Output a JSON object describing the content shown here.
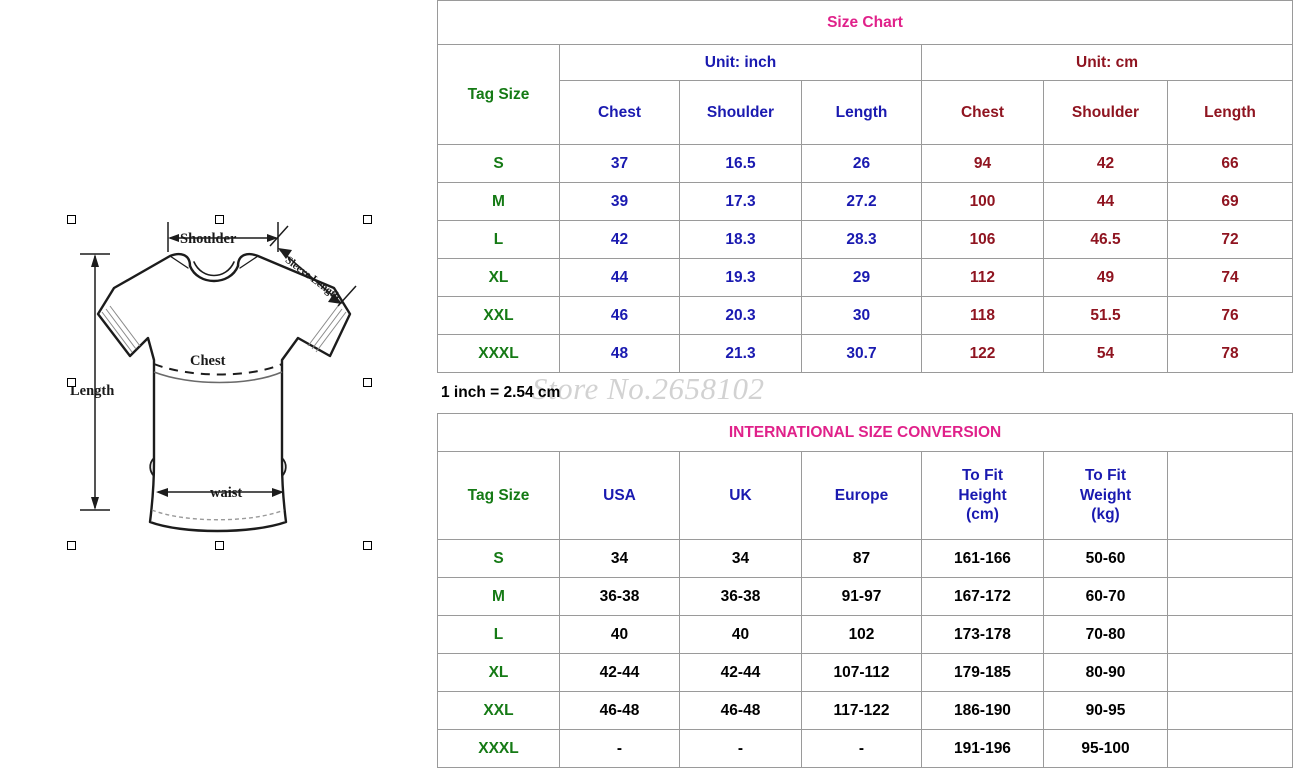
{
  "diagram": {
    "name": "t-shirt-measurement-diagram",
    "labels": {
      "shoulder": "Shoulder",
      "sleeve": "Sleeve Length",
      "chest": "Chest",
      "length": "Length",
      "waist": "waist"
    }
  },
  "size_chart": {
    "title": "Size Chart",
    "tag_size_header": "Tag Size",
    "unit_groups": [
      {
        "label": "Unit: inch",
        "color": "#1a1ab0"
      },
      {
        "label": "Unit: cm",
        "color": "#8f1420"
      }
    ],
    "column_headers_inch": [
      "Chest",
      "Shoulder",
      "Length"
    ],
    "column_headers_cm": [
      "Chest",
      "Shoulder",
      "Length"
    ],
    "rows": [
      {
        "tag": "S",
        "inch": [
          "37",
          "16.5",
          "26"
        ],
        "cm": [
          "94",
          "42",
          "66"
        ]
      },
      {
        "tag": "M",
        "inch": [
          "39",
          "17.3",
          "27.2"
        ],
        "cm": [
          "100",
          "44",
          "69"
        ]
      },
      {
        "tag": "L",
        "inch": [
          "42",
          "18.3",
          "28.3"
        ],
        "cm": [
          "106",
          "46.5",
          "72"
        ]
      },
      {
        "tag": "XL",
        "inch": [
          "44",
          "19.3",
          "29"
        ],
        "cm": [
          "112",
          "49",
          "74"
        ]
      },
      {
        "tag": "XXL",
        "inch": [
          "46",
          "20.3",
          "30"
        ],
        "cm": [
          "118",
          "51.5",
          "76"
        ]
      },
      {
        "tag": "XXXL",
        "inch": [
          "48",
          "21.3",
          "30.7"
        ],
        "cm": [
          "122",
          "54",
          "78"
        ]
      }
    ],
    "conversion_note": "1 inch = 2.54 cm",
    "watermark": "Store No.2658102"
  },
  "international_chart": {
    "title": "INTERNATIONAL SIZE CONVERSION",
    "column_headers": [
      "Tag Size",
      "USA",
      "UK",
      "Europe",
      "To Fit Height (cm)",
      "To Fit Weight (kg)",
      ""
    ],
    "header_lines": {
      "height": [
        "To Fit",
        "Height",
        "(cm)"
      ],
      "weight": [
        "To Fit",
        "Weight",
        "(kg)"
      ]
    },
    "rows": [
      {
        "tag": "S",
        "usa": "34",
        "uk": "34",
        "europe": "87",
        "height": "161-166",
        "weight": "50-60",
        "extra": ""
      },
      {
        "tag": "M",
        "usa": "36-38",
        "uk": "36-38",
        "europe": "91-97",
        "height": "167-172",
        "weight": "60-70",
        "extra": ""
      },
      {
        "tag": "L",
        "usa": "40",
        "uk": "40",
        "europe": "102",
        "height": "173-178",
        "weight": "70-80",
        "extra": ""
      },
      {
        "tag": "XL",
        "usa": "42-44",
        "uk": "42-44",
        "europe": "107-112",
        "height": "179-185",
        "weight": "80-90",
        "extra": ""
      },
      {
        "tag": "XXL",
        "usa": "46-48",
        "uk": "46-48",
        "europe": "117-122",
        "height": "186-190",
        "weight": "90-95",
        "extra": ""
      },
      {
        "tag": "XXXL",
        "usa": "-",
        "uk": "-",
        "europe": "-",
        "height": "191-196",
        "weight": "95-100",
        "extra": ""
      }
    ]
  },
  "colors": {
    "title_pink": "#e0218a",
    "tag_green": "#157a15",
    "inch_blue": "#1a1ab0",
    "cm_darkred": "#8f1420",
    "value_black": "#000000",
    "border_gray": "#9a9a9a",
    "watermark_gray": "#d2d2d2"
  }
}
